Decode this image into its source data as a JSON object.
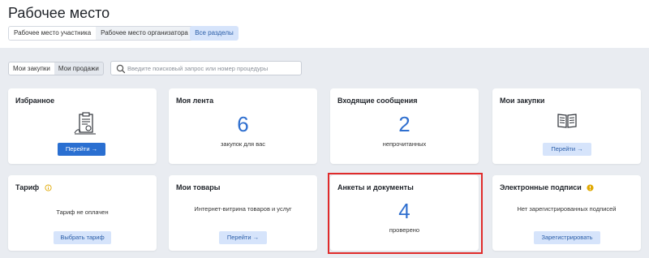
{
  "header": {
    "title": "Рабочее место",
    "workspace_tabs": [
      {
        "label": "Рабочее место участника",
        "active": true
      },
      {
        "label": "Рабочее место организатора",
        "active": false
      }
    ],
    "all_sections_label": "Все разделы"
  },
  "filters": {
    "tabs": [
      {
        "label": "Мои закупки",
        "active": true
      },
      {
        "label": "Мои продажи",
        "active": false
      }
    ],
    "search_placeholder": "Введите поисковый запрос или номер процедуры"
  },
  "cards": {
    "favorites": {
      "title": "Избранное",
      "button": "Перейти →",
      "icon": "clipboard-document-icon"
    },
    "feed": {
      "title": "Моя лента",
      "number": "6",
      "caption": "закупок для вас"
    },
    "inbox": {
      "title": "Входящие сообщения",
      "number": "2",
      "caption": "непрочитанных"
    },
    "purchases": {
      "title": "Мои закупки",
      "button": "Перейти →",
      "icon": "open-book-icon"
    },
    "tariff": {
      "title": "Тариф",
      "caption": "Тариф не оплачен",
      "button": "Выбрать тариф",
      "icon": "info-circle-icon"
    },
    "goods": {
      "title": "Мои товары",
      "caption": "Интернет-витрина товаров и услуг",
      "button": "Перейти →"
    },
    "documents": {
      "title": "Анкеты и документы",
      "number": "4",
      "caption": "проверено"
    },
    "signatures": {
      "title": "Электронные подписи",
      "caption": "Нет зарегистрированных подписей",
      "button": "Зарегистрировать",
      "icon": "warning-circle-icon"
    }
  },
  "colors": {
    "accent": "#2a6fd1",
    "number_blue": "#2f6fcf",
    "highlight": "#e02b2b",
    "warning": "#e0a800"
  }
}
